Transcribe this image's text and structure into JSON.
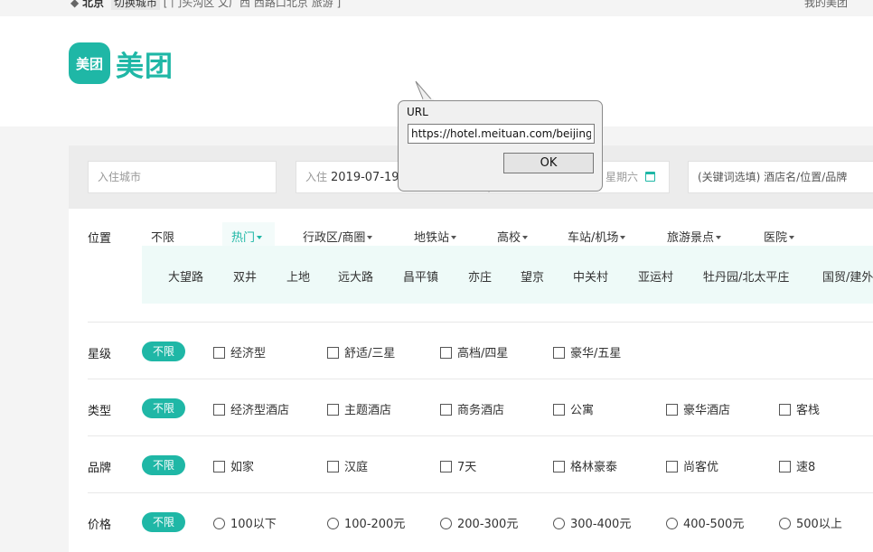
{
  "topbar": {
    "city": "北京",
    "switch_city": "切换城市",
    "nearby": "[ 门头沟区 文广西 西路口北京 旅游 ]",
    "my_meituan": "我的美团"
  },
  "logo": {
    "badge": "美团",
    "text": "美团"
  },
  "search": {
    "city_placeholder": "入住城市",
    "checkin_label": "入住",
    "checkin_value": "2019-07-19",
    "checkout_weekday": "星期六",
    "keyword_placeholder": "(关键词选填) 酒店名/位置/品牌"
  },
  "location": {
    "label": "位置",
    "items": [
      "不限",
      "热门",
      "行政区/商圈",
      "地铁站",
      "高校",
      "车站/机场",
      "旅游景点",
      "医院"
    ],
    "hot_areas": [
      "大望路",
      "双井",
      "上地",
      "远大路",
      "昌平镇",
      "亦庄",
      "望京",
      "中关村",
      "亚运村",
      "牡丹园/北太平庄",
      "国贸/建外"
    ]
  },
  "filters": {
    "unlimited": "不限",
    "star": {
      "label": "星级",
      "options": [
        "经济型",
        "舒适/三星",
        "高档/四星",
        "豪华/五星"
      ]
    },
    "type": {
      "label": "类型",
      "options": [
        "经济型酒店",
        "主题酒店",
        "商务酒店",
        "公寓",
        "豪华酒店",
        "客栈"
      ]
    },
    "brand": {
      "label": "品牌",
      "options": [
        "如家",
        "汉庭",
        "7天",
        "格林豪泰",
        "尚客优",
        "速8"
      ]
    },
    "price": {
      "label": "价格",
      "options": [
        "100以下",
        "100-200元",
        "200-300元",
        "300-400元",
        "400-500元",
        "500以上"
      ]
    }
  },
  "dialog": {
    "title": "URL",
    "url": "https://hotel.meituan.com/beijing/",
    "ok": "OK"
  },
  "colors": {
    "brand": "#1fb7a6"
  }
}
